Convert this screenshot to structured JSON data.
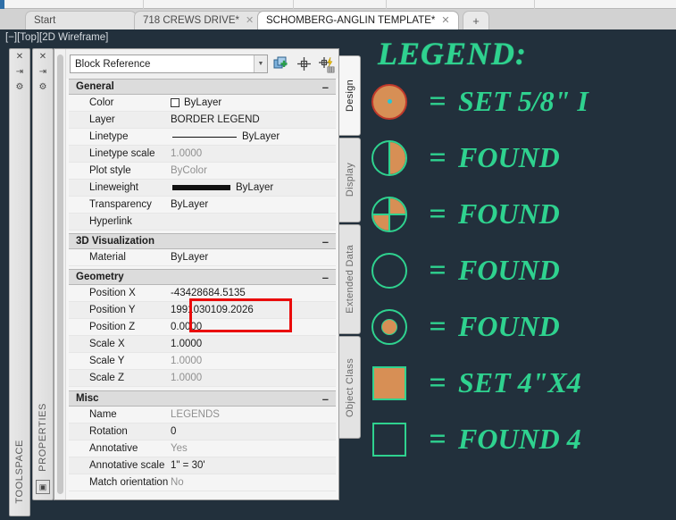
{
  "window": {
    "viewport_label": "[−][Top][2D Wireframe]"
  },
  "tabs": {
    "items": [
      {
        "label": "Start",
        "close": "",
        "active": false
      },
      {
        "label": "718 CREWS DRIVE*",
        "close": "✕",
        "active": false
      },
      {
        "label": "SCHOMBERG-ANGLIN TEMPLATE*",
        "close": "✕",
        "active": true
      }
    ],
    "new_tab_label": "+"
  },
  "dock_panels": [
    {
      "title": "TOOLSPACE",
      "icons": [
        "✕",
        "⇥",
        "⚙"
      ]
    },
    {
      "title": "PROPERTIES",
      "icons": [
        "✕",
        "⇥",
        "⚙"
      ],
      "bottom_icon": "▣"
    }
  ],
  "properties": {
    "object_type": "Block Reference",
    "dropdown_arrow": "▼",
    "toolbar_icons": [
      "select-objects-icon",
      "pick-point-icon",
      "quick-select-icon"
    ],
    "collapse_glyph": "–",
    "sections": [
      {
        "name": "General",
        "rows": [
          {
            "key": "Color",
            "value": "ByLayer",
            "grey": false,
            "widget": "color-swatch"
          },
          {
            "key": "Layer",
            "value": "BORDER LEGEND",
            "grey": false,
            "widget": ""
          },
          {
            "key": "Linetype",
            "value": "ByLayer",
            "grey": false,
            "widget": "linetype-preview"
          },
          {
            "key": "Linetype scale",
            "value": "1.0000",
            "grey": true,
            "widget": ""
          },
          {
            "key": "Plot style",
            "value": "ByColor",
            "grey": true,
            "widget": ""
          },
          {
            "key": "Lineweight",
            "value": "ByLayer",
            "grey": false,
            "widget": "lineweight-preview"
          },
          {
            "key": "Transparency",
            "value": "ByLayer",
            "grey": false,
            "widget": ""
          },
          {
            "key": "Hyperlink",
            "value": "",
            "grey": false,
            "widget": ""
          }
        ]
      },
      {
        "name": "3D Visualization",
        "rows": [
          {
            "key": "Material",
            "value": "ByLayer",
            "grey": false,
            "widget": ""
          }
        ]
      },
      {
        "name": "Geometry",
        "rows": [
          {
            "key": "Position X",
            "value": "-43428684.5135",
            "grey": false,
            "widget": ""
          },
          {
            "key": "Position Y",
            "value": "1991030109.2026",
            "grey": false,
            "widget": ""
          },
          {
            "key": "Position Z",
            "value": "0.0000",
            "grey": false,
            "widget": ""
          },
          {
            "key": "Scale X",
            "value": "1.0000",
            "grey": false,
            "widget": ""
          },
          {
            "key": "Scale Y",
            "value": "1.0000",
            "grey": true,
            "widget": ""
          },
          {
            "key": "Scale Z",
            "value": "1.0000",
            "grey": true,
            "widget": ""
          }
        ]
      },
      {
        "name": "Misc",
        "rows": [
          {
            "key": "Name",
            "value": "LEGENDS",
            "grey": true,
            "widget": ""
          },
          {
            "key": "Rotation",
            "value": "0",
            "grey": false,
            "widget": ""
          },
          {
            "key": "Annotative",
            "value": "Yes",
            "grey": true,
            "widget": ""
          },
          {
            "key": "Annotative scale",
            "value": "1\" = 30'",
            "grey": false,
            "widget": ""
          },
          {
            "key": "Match  orientation...",
            "value": "No",
            "grey": true,
            "widget": ""
          }
        ]
      }
    ],
    "highlight_color": "#ea0b0b"
  },
  "side_tabs": [
    {
      "label": "Design",
      "active": true
    },
    {
      "label": "Display",
      "active": false
    },
    {
      "label": "Extended Data",
      "active": false
    },
    {
      "label": "Object Class",
      "active": false
    }
  ],
  "legend": {
    "title": "LEGEND:",
    "equals": "=",
    "accent_green": "#2fd28f",
    "accent_orange": "#d78f55",
    "entries": [
      {
        "symbol": "circle-filled",
        "text": "SET 5/8\" I"
      },
      {
        "symbol": "circle-half",
        "text": "FOUND"
      },
      {
        "symbol": "circle-quad",
        "text": "FOUND"
      },
      {
        "symbol": "circle-open",
        "text": "FOUND"
      },
      {
        "symbol": "circle-target",
        "text": "FOUND"
      },
      {
        "symbol": "square-filled",
        "text": "SET 4\"X4"
      },
      {
        "symbol": "square-open",
        "text": "FOUND 4"
      }
    ]
  }
}
